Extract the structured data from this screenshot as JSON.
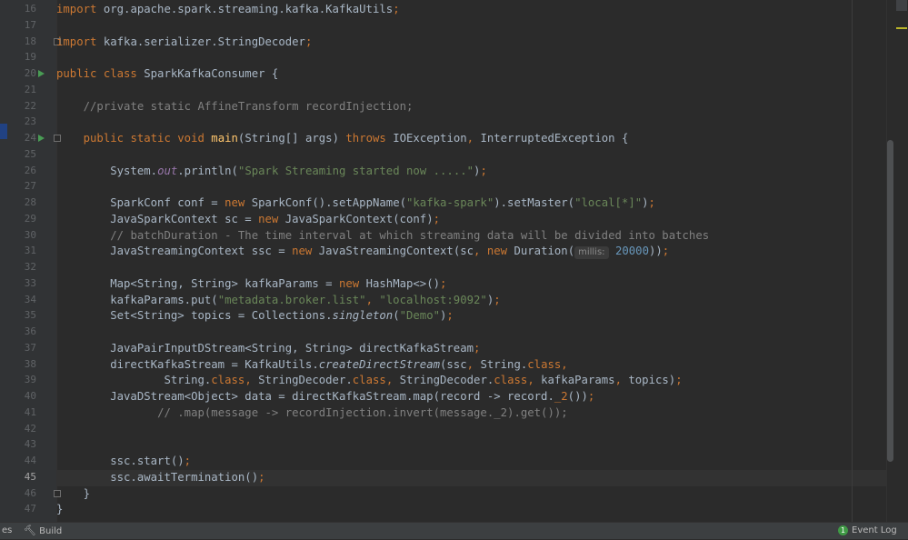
{
  "editor": {
    "line_numbers": [
      "16",
      "17",
      "18",
      "19",
      "20",
      "21",
      "22",
      "23",
      "24",
      "25",
      "26",
      "27",
      "28",
      "29",
      "30",
      "31",
      "32",
      "33",
      "34",
      "35",
      "36",
      "37",
      "38",
      "39",
      "40",
      "41",
      "42",
      "43",
      "44",
      "45",
      "46",
      "47"
    ],
    "lines": [
      [
        {
          "t": "import ",
          "c": "kw"
        },
        {
          "t": "org.apache.spark.streaming.kafka.KafkaUtils"
        },
        {
          "t": ";",
          "c": "kw"
        }
      ],
      [],
      [
        {
          "t": "import ",
          "c": "kw"
        },
        {
          "t": "kafka.serializer.StringDecoder"
        },
        {
          "t": ";",
          "c": "kw"
        }
      ],
      [],
      [
        {
          "t": "public class ",
          "c": "kw"
        },
        {
          "t": "SparkKafkaConsumer {"
        }
      ],
      [],
      [
        {
          "t": "    "
        },
        {
          "t": "//private static AffineTransform recordInjection;",
          "c": "cm"
        }
      ],
      [],
      [
        {
          "t": "    "
        },
        {
          "t": "public static void ",
          "c": "kw"
        },
        {
          "t": "main",
          "c": "fn"
        },
        {
          "t": "(String[] args) "
        },
        {
          "t": "throws ",
          "c": "kw"
        },
        {
          "t": "IOException"
        },
        {
          "t": ", ",
          "c": "kw"
        },
        {
          "t": "InterruptedException {"
        }
      ],
      [],
      [
        {
          "t": "        System."
        },
        {
          "t": "out",
          "c": "fld"
        },
        {
          "t": ".println("
        },
        {
          "t": "\"Spark Streaming started now .....\"",
          "c": "str"
        },
        {
          "t": ")"
        },
        {
          "t": ";",
          "c": "kw"
        }
      ],
      [],
      [
        {
          "t": "        SparkConf conf = "
        },
        {
          "t": "new ",
          "c": "kw"
        },
        {
          "t": "SparkConf().setAppName("
        },
        {
          "t": "\"kafka-spark\"",
          "c": "str"
        },
        {
          "t": ").setMaster("
        },
        {
          "t": "\"local[*]\"",
          "c": "str"
        },
        {
          "t": ")"
        },
        {
          "t": ";",
          "c": "kw"
        }
      ],
      [
        {
          "t": "        JavaSparkContext sc = "
        },
        {
          "t": "new ",
          "c": "kw"
        },
        {
          "t": "JavaSparkContext(conf)"
        },
        {
          "t": ";",
          "c": "kw"
        }
      ],
      [
        {
          "t": "        "
        },
        {
          "t": "// batchDuration - The time interval at which streaming data will be divided into batches",
          "c": "cm"
        }
      ],
      [
        {
          "t": "        JavaStreamingContext ssc = "
        },
        {
          "t": "new ",
          "c": "kw"
        },
        {
          "t": "JavaStreamingContext(sc"
        },
        {
          "t": ", ",
          "c": "kw"
        },
        {
          "t": "new ",
          "c": "kw"
        },
        {
          "t": "Duration("
        },
        {
          "t": "millis:",
          "c": "hint"
        },
        {
          "t": " "
        },
        {
          "t": "20000",
          "c": "num"
        },
        {
          "t": "))"
        },
        {
          "t": ";",
          "c": "kw"
        }
      ],
      [],
      [
        {
          "t": "        Map<String, String> kafkaParams = "
        },
        {
          "t": "new ",
          "c": "kw"
        },
        {
          "t": "HashMap<>()"
        },
        {
          "t": ";",
          "c": "kw"
        }
      ],
      [
        {
          "t": "        kafkaParams.put("
        },
        {
          "t": "\"metadata.broker.list\"",
          "c": "str"
        },
        {
          "t": ", ",
          "c": "kw"
        },
        {
          "t": "\"localhost:9092\"",
          "c": "str"
        },
        {
          "t": ")"
        },
        {
          "t": ";",
          "c": "kw"
        }
      ],
      [
        {
          "t": "        Set<String> topics = Collections."
        },
        {
          "t": "singleton",
          "c": "it"
        },
        {
          "t": "("
        },
        {
          "t": "\"Demo\"",
          "c": "str"
        },
        {
          "t": ")"
        },
        {
          "t": ";",
          "c": "kw"
        }
      ],
      [],
      [
        {
          "t": "        JavaPairInputDStream<String, String> directKafkaStream"
        },
        {
          "t": ";",
          "c": "kw"
        }
      ],
      [
        {
          "t": "        directKafkaStream = KafkaUtils."
        },
        {
          "t": "createDirectStream",
          "c": "it"
        },
        {
          "t": "(ssc"
        },
        {
          "t": ", ",
          "c": "kw"
        },
        {
          "t": "String."
        },
        {
          "t": "class",
          "c": "kw"
        },
        {
          "t": ",",
          "c": "kw"
        }
      ],
      [
        {
          "t": "                String."
        },
        {
          "t": "class",
          "c": "kw"
        },
        {
          "t": ", ",
          "c": "kw"
        },
        {
          "t": "StringDecoder."
        },
        {
          "t": "class",
          "c": "kw"
        },
        {
          "t": ", ",
          "c": "kw"
        },
        {
          "t": "StringDecoder."
        },
        {
          "t": "class",
          "c": "kw"
        },
        {
          "t": ", ",
          "c": "kw"
        },
        {
          "t": "kafkaParams"
        },
        {
          "t": ", ",
          "c": "kw"
        },
        {
          "t": "topics)"
        },
        {
          "t": ";",
          "c": "kw"
        }
      ],
      [
        {
          "t": "        JavaDStream<Object> data = directKafkaStream.map(record -> record."
        },
        {
          "t": "_2",
          "c": "kw"
        },
        {
          "t": "())"
        },
        {
          "t": ";",
          "c": "kw"
        }
      ],
      [
        {
          "t": "               "
        },
        {
          "t": "// .map(message -> recordInjection.invert(message._2).get());",
          "c": "cm"
        }
      ],
      [],
      [],
      [
        {
          "t": "        ssc.start()"
        },
        {
          "t": ";",
          "c": "kw"
        }
      ],
      [
        {
          "t": "        ssc.awaitTermination()"
        },
        {
          "t": ";",
          "c": "kw"
        }
      ],
      [
        {
          "t": "    }"
        }
      ],
      [
        {
          "t": "}"
        }
      ]
    ]
  },
  "status_bar": {
    "left_truncated": "es",
    "build_label": "Build",
    "event_log_count": "1",
    "event_log_label": "Event Log"
  }
}
